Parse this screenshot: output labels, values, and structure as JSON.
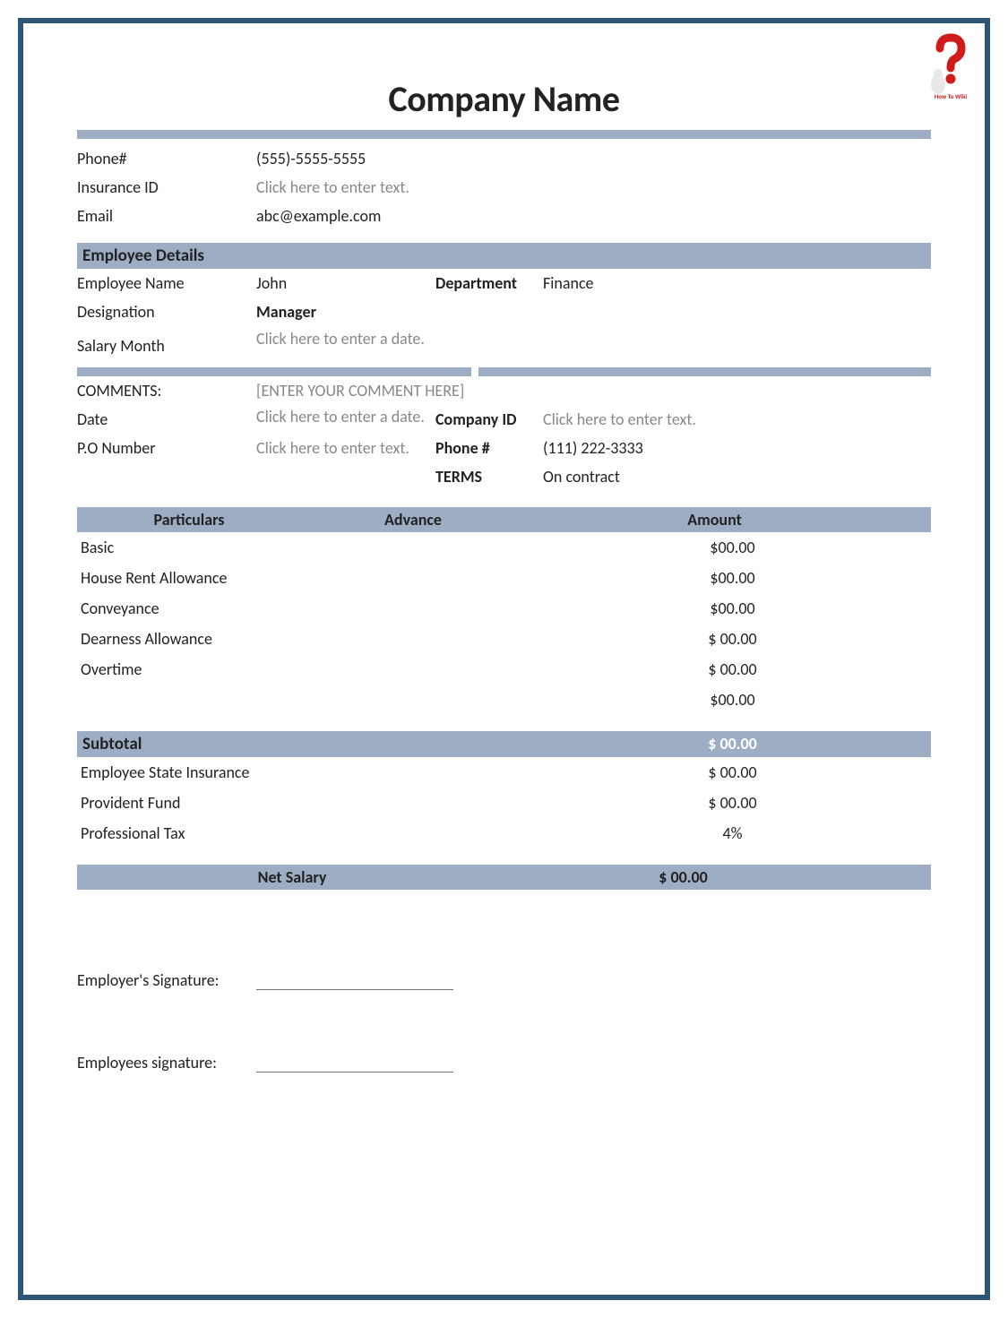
{
  "title": "Company Name",
  "logo_caption": "How To Wiki",
  "company_info": {
    "phone_label": "Phone#",
    "phone_value": "(555)-5555-5555",
    "insurance_label": "Insurance ID",
    "insurance_value": "Click here to enter text.",
    "email_label": "Email",
    "email_value": "abc@example.com"
  },
  "employee_header": "Employee Details",
  "employee": {
    "name_label": "Employee Name",
    "name_value": "John",
    "dept_label": "Department",
    "dept_value": "Finance",
    "designation_label": "Designation",
    "designation_value": "Manager",
    "salary_month_label": "Salary Month",
    "salary_month_value": "Click here to enter a date."
  },
  "comments": {
    "label": "COMMENTS:",
    "value": "[ENTER YOUR COMMENT HERE]",
    "date_label": "Date",
    "date_value": "Click here to enter a date.",
    "companyid_label": "Company ID",
    "companyid_value": "Click here to enter text.",
    "po_label": "P.O Number",
    "po_value": "Click here to enter text.",
    "phone_label": "Phone #",
    "phone_value": "(111) 222-3333",
    "terms_label": "TERMS",
    "terms_value": "On contract"
  },
  "table": {
    "h_particulars": "Particulars",
    "h_advance": "Advance",
    "h_amount": "Amount",
    "rows": [
      {
        "label": "Basic",
        "amount": "$00.00"
      },
      {
        "label": "House Rent Allowance",
        "amount": "$00.00"
      },
      {
        "label": "Conveyance",
        "amount": "$00.00"
      },
      {
        "label": "Dearness Allowance",
        "amount": "$ 00.00"
      },
      {
        "label": "Overtime",
        "amount": "$ 00.00"
      },
      {
        "label": "",
        "amount": "$00.00"
      }
    ],
    "subtotal_label": "Subtotal",
    "subtotal_amount": "$ 00.00",
    "deductions": [
      {
        "label": "Employee State Insurance",
        "amount": "$ 00.00"
      },
      {
        "label": "Provident Fund",
        "amount": "$ 00.00"
      },
      {
        "label": "Professional Tax",
        "amount": "4%"
      }
    ],
    "net_label": "Net Salary",
    "net_amount": "$ 00.00"
  },
  "signatures": {
    "employer": "Employer's Signature:",
    "employee": "Employees signature:"
  }
}
